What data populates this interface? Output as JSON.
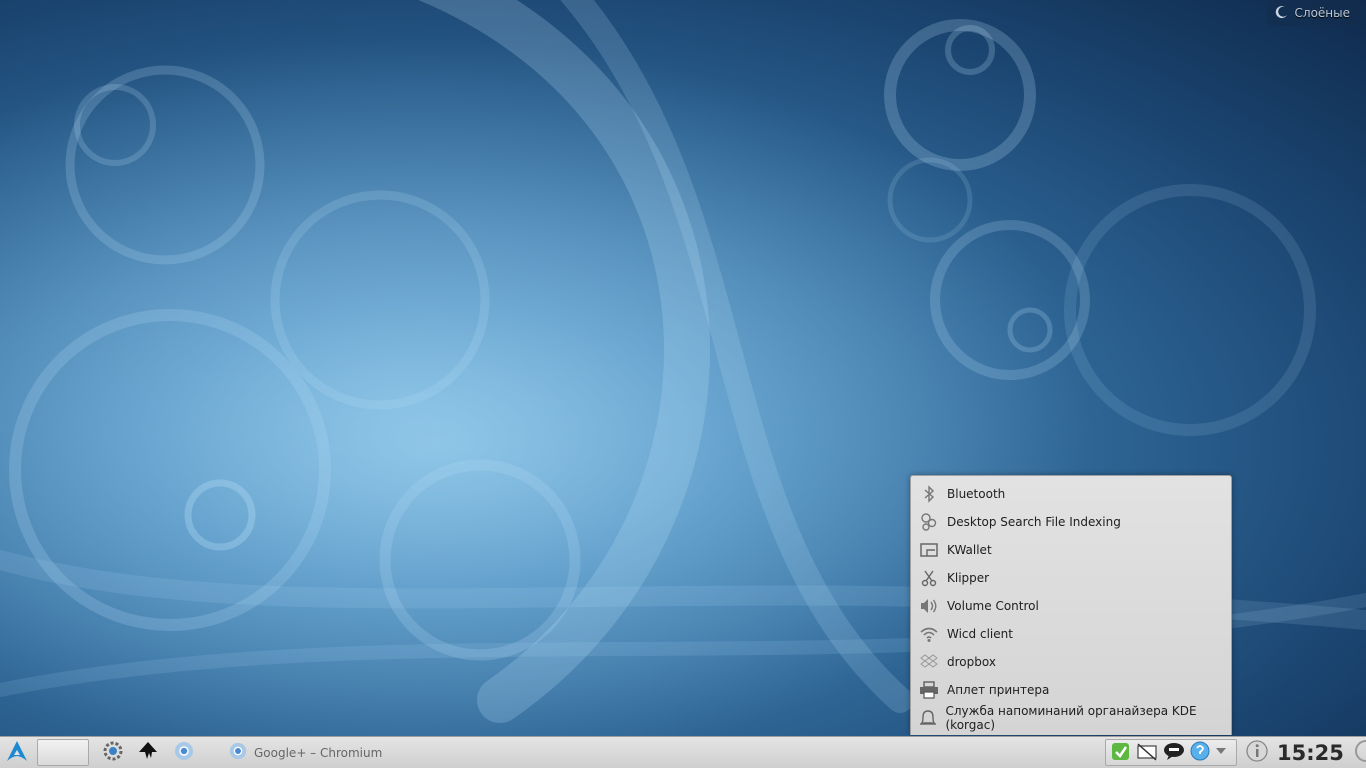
{
  "desktop": {
    "activity_label": "Слоёные"
  },
  "tray_popup": {
    "items": [
      {
        "label": "Bluetooth",
        "icon": "bluetooth-icon"
      },
      {
        "label": "Desktop Search File Indexing",
        "icon": "search-indexing-icon"
      },
      {
        "label": "KWallet",
        "icon": "wallet-icon"
      },
      {
        "label": "Klipper",
        "icon": "scissors-icon"
      },
      {
        "label": "Volume Control",
        "icon": "speaker-icon"
      },
      {
        "label": "Wicd client",
        "icon": "wifi-icon"
      },
      {
        "label": "dropbox",
        "icon": "dropbox-icon"
      },
      {
        "label": "Аплет принтера",
        "icon": "printer-icon"
      },
      {
        "label": "Служба напоминаний органайзера KDE (korgac)",
        "icon": "bell-icon"
      }
    ]
  },
  "taskbar": {
    "launchers": [
      {
        "name": "system-settings-launcher",
        "icon": "gear-icon"
      },
      {
        "name": "inkscape-launcher",
        "icon": "inkscape-icon"
      },
      {
        "name": "chromium-launcher",
        "icon": "chromium-icon"
      }
    ],
    "task_label": "Google+ – Chromium",
    "clock": "15:25"
  }
}
